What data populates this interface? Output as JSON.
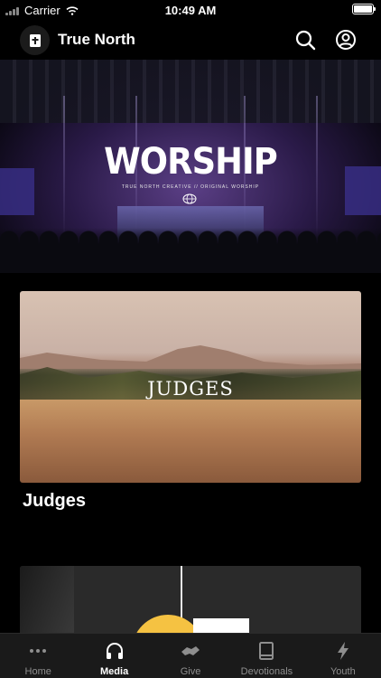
{
  "status_bar": {
    "carrier": "Carrier",
    "time": "10:49 AM"
  },
  "header": {
    "title": "True North"
  },
  "hero": {
    "title": "WORSHIP",
    "subtitle": "TRUE NORTH CREATIVE // ORIGINAL WORSHIP"
  },
  "feed": [
    {
      "overlay_text": "JUDGES",
      "title": "Judges"
    }
  ],
  "tabs": [
    {
      "label": "Home",
      "icon": "more-dots-icon",
      "active": false
    },
    {
      "label": "Media",
      "icon": "headphones-icon",
      "active": true
    },
    {
      "label": "Give",
      "icon": "handshake-icon",
      "active": false
    },
    {
      "label": "Devotionals",
      "icon": "book-icon",
      "active": false
    },
    {
      "label": "Youth",
      "icon": "bolt-icon",
      "active": false
    }
  ],
  "colors": {
    "background": "#000000",
    "tab_bar": "#1a1a1a",
    "inactive": "#8e8e8e",
    "active": "#ffffff"
  }
}
